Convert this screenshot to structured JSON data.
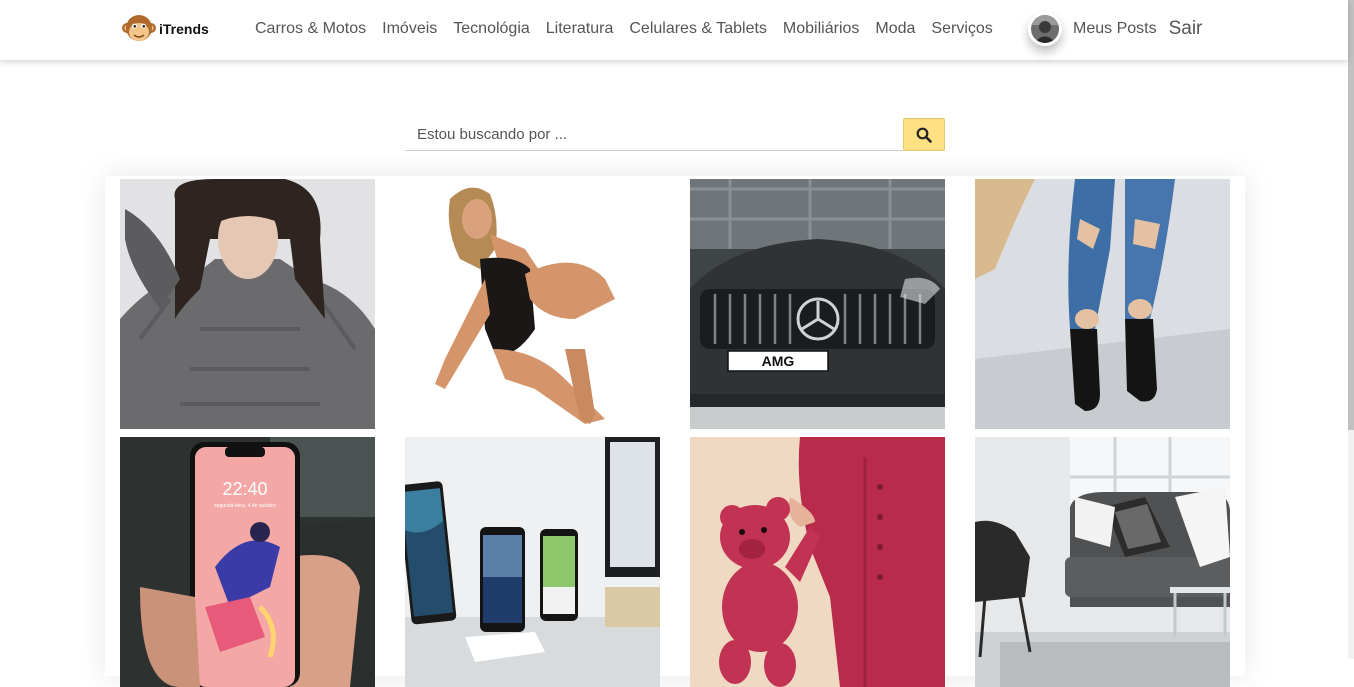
{
  "brand": {
    "name": "iTrends",
    "logo_icon": "monkey-icon"
  },
  "nav": {
    "items": [
      "Carros & Motos",
      "Imóveis",
      "Tecnológia",
      "Literatura",
      "Celulares & Tablets",
      "Mobiliários",
      "Moda",
      "Serviços"
    ]
  },
  "user": {
    "my_posts": "Meus Posts",
    "logout": "Sair"
  },
  "search": {
    "placeholder": "Estou buscando por ...",
    "value": "",
    "button_icon": "search-icon"
  },
  "phone_screen": {
    "time": "22:40",
    "date": "segunda-feira, 4 de outubro"
  },
  "car_plate": "AMG",
  "colors": {
    "search_button": "#ffe083",
    "header_bg": "#ffffff",
    "text": "#555555"
  }
}
